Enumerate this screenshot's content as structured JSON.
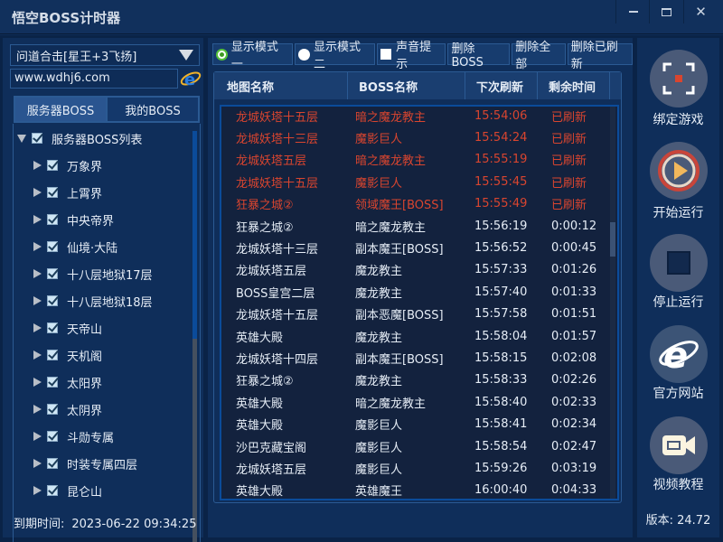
{
  "window": {
    "title": "悟空BOSS计时器",
    "minimize_icon": "minimize-icon",
    "maximize_icon": "maximize-icon",
    "close_icon": "close-icon"
  },
  "left": {
    "server_select": "问道合击[星王+3飞扬]",
    "url": "www.wdhj6.com",
    "tabs": [
      {
        "label": "服务器BOSS",
        "active": true
      },
      {
        "label": "我的BOSS",
        "active": false
      }
    ],
    "tree_root": "服务器BOSS列表",
    "tree_items": [
      "万象界",
      "上霄界",
      "中央帝界",
      "仙境·大陆",
      "十八层地狱17层",
      "十八层地狱18层",
      "天帝山",
      "天机阁",
      "太阳界",
      "太阴界",
      "斗勋专属",
      "时装专属四层",
      "昆仑山"
    ],
    "expire_label": "到期时间:",
    "expire_value": "2023-06-22 09:34:25"
  },
  "toolbar": {
    "mode1": "显示模式一",
    "mode2": "显示模式二",
    "sound": "声音提示",
    "delete_boss": "删除BOSS",
    "delete_all": "删除全部",
    "delete_refreshed": "删除已刷新"
  },
  "grid": {
    "headers": [
      "地图名称",
      "BOSS名称",
      "下次刷新",
      "剩余时间"
    ],
    "refreshed_color": "#d9452f",
    "rows": [
      {
        "map": "龙城妖塔十五层",
        "boss": "暗之魔龙教主",
        "next": "15:54:06",
        "remain": "已刷新",
        "status": "refreshed"
      },
      {
        "map": "龙城妖塔十三层",
        "boss": "魔影巨人",
        "next": "15:54:24",
        "remain": "已刷新",
        "status": "refreshed"
      },
      {
        "map": "龙城妖塔五层",
        "boss": "暗之魔龙教主",
        "next": "15:55:19",
        "remain": "已刷新",
        "status": "refreshed"
      },
      {
        "map": "龙城妖塔十五层",
        "boss": "魔影巨人",
        "next": "15:55:45",
        "remain": "已刷新",
        "status": "refreshed"
      },
      {
        "map": "狂暴之城②",
        "boss": "领域魔王[BOSS]",
        "next": "15:55:49",
        "remain": "已刷新",
        "status": "refreshed"
      },
      {
        "map": "狂暴之城②",
        "boss": "暗之魔龙教主",
        "next": "15:56:19",
        "remain": "0:00:12",
        "status": "pending"
      },
      {
        "map": "龙城妖塔十三层",
        "boss": "副本魔王[BOSS]",
        "next": "15:56:52",
        "remain": "0:00:45",
        "status": "pending"
      },
      {
        "map": "龙城妖塔五层",
        "boss": "魔龙教主",
        "next": "15:57:33",
        "remain": "0:01:26",
        "status": "pending"
      },
      {
        "map": "BOSS皇宫二层",
        "boss": "魔龙教主",
        "next": "15:57:40",
        "remain": "0:01:33",
        "status": "pending"
      },
      {
        "map": "龙城妖塔十五层",
        "boss": "副本恶魔[BOSS]",
        "next": "15:57:58",
        "remain": "0:01:51",
        "status": "pending"
      },
      {
        "map": "英雄大殿",
        "boss": "魔龙教主",
        "next": "15:58:04",
        "remain": "0:01:57",
        "status": "pending"
      },
      {
        "map": "龙城妖塔十四层",
        "boss": "副本魔王[BOSS]",
        "next": "15:58:15",
        "remain": "0:02:08",
        "status": "pending"
      },
      {
        "map": "狂暴之城②",
        "boss": "魔龙教主",
        "next": "15:58:33",
        "remain": "0:02:26",
        "status": "pending"
      },
      {
        "map": "英雄大殿",
        "boss": "暗之魔龙教主",
        "next": "15:58:40",
        "remain": "0:02:33",
        "status": "pending"
      },
      {
        "map": "英雄大殿",
        "boss": "魔影巨人",
        "next": "15:58:41",
        "remain": "0:02:34",
        "status": "pending"
      },
      {
        "map": "沙巴克藏宝阁",
        "boss": "魔影巨人",
        "next": "15:58:54",
        "remain": "0:02:47",
        "status": "pending"
      },
      {
        "map": "龙城妖塔五层",
        "boss": "魔影巨人",
        "next": "15:59:26",
        "remain": "0:03:19",
        "status": "pending"
      },
      {
        "map": "英雄大殿",
        "boss": "英雄魔王",
        "next": "16:00:40",
        "remain": "0:04:33",
        "status": "pending"
      }
    ]
  },
  "right": {
    "buttons": [
      {
        "label": "绑定游戏",
        "icon": "bind-target-icon"
      },
      {
        "label": "开始运行",
        "icon": "play-icon"
      },
      {
        "label": "停止运行",
        "icon": "stop-icon"
      },
      {
        "label": "官方网站",
        "icon": "ie-browser-icon"
      },
      {
        "label": "视频教程",
        "icon": "video-camera-icon"
      }
    ],
    "version": "版本: 24.72"
  }
}
